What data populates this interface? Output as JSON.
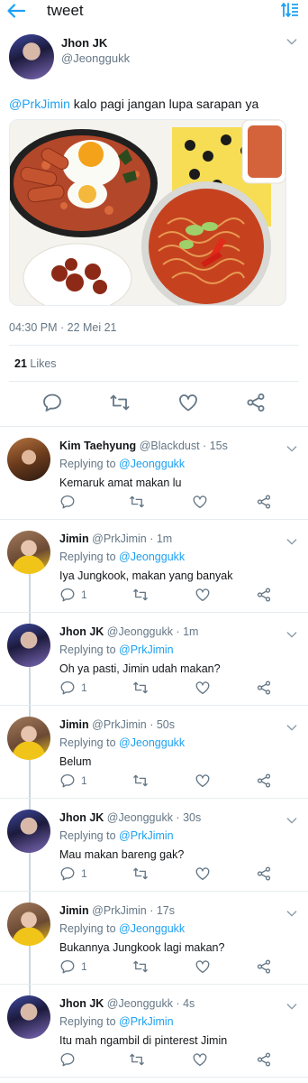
{
  "header": {
    "title": "tweet",
    "back_icon": "arrow-left-icon",
    "sort_icon": "sort-icon",
    "accent": "#1da1f2"
  },
  "main_tweet": {
    "name": "Jhon JK",
    "handle": "@Jeonggukk",
    "mention": "@PrkJimin",
    "text": " kalo pagi jangan lupa sarapan ya",
    "time": "04:30 PM · 22 Mei 21",
    "likes_count": "21",
    "likes_label": " Likes"
  },
  "replies": [
    {
      "name": "Kim Taehyung",
      "handle": "@Blackdust",
      "time": "15s",
      "replying_label": "Replying to ",
      "replying_to": "@Jeonggukk",
      "text": "Kemaruk amat makan lu",
      "reply_count": "",
      "avatar": "tae"
    },
    {
      "name": "Jimin",
      "handle": "@PrkJimin",
      "time": "1m",
      "replying_label": "Replying to ",
      "replying_to": "@Jeonggukk",
      "text": "Iya Jungkook, makan yang banyak",
      "reply_count": "1",
      "avatar": "jimin"
    },
    {
      "name": "Jhon JK",
      "handle": "@Jeonggukk",
      "time": "1m",
      "replying_label": "Replying to ",
      "replying_to": "@PrkJimin",
      "text": "Oh ya pasti, Jimin udah makan?",
      "reply_count": "1",
      "avatar": "jk"
    },
    {
      "name": "Jimin",
      "handle": "@PrkJimin",
      "time": "50s",
      "replying_label": "Replying to ",
      "replying_to": "@Jeonggukk",
      "text": "Belum",
      "reply_count": "1",
      "avatar": "jimin"
    },
    {
      "name": "Jhon JK",
      "handle": "@Jeonggukk",
      "time": "30s",
      "replying_label": "Replying to ",
      "replying_to": "@PrkJimin",
      "text": "Mau makan bareng gak?",
      "reply_count": "1",
      "avatar": "jk"
    },
    {
      "name": "Jimin",
      "handle": "@PrkJimin",
      "time": "17s",
      "replying_label": "Replying to ",
      "replying_to": "@Jeonggukk",
      "text": "Bukannya Jungkook lagi makan?",
      "reply_count": "1",
      "avatar": "jimin"
    },
    {
      "name": "Jhon JK",
      "handle": "@Jeonggukk",
      "time": "4s",
      "replying_label": "Replying to ",
      "replying_to": "@PrkJimin",
      "text": "Itu mah ngambil di pinterest Jimin",
      "reply_count": "",
      "avatar": "jk"
    }
  ],
  "icons": [
    "reply-icon",
    "retweet-icon",
    "heart-icon",
    "share-icon",
    "chevron-down-icon"
  ]
}
